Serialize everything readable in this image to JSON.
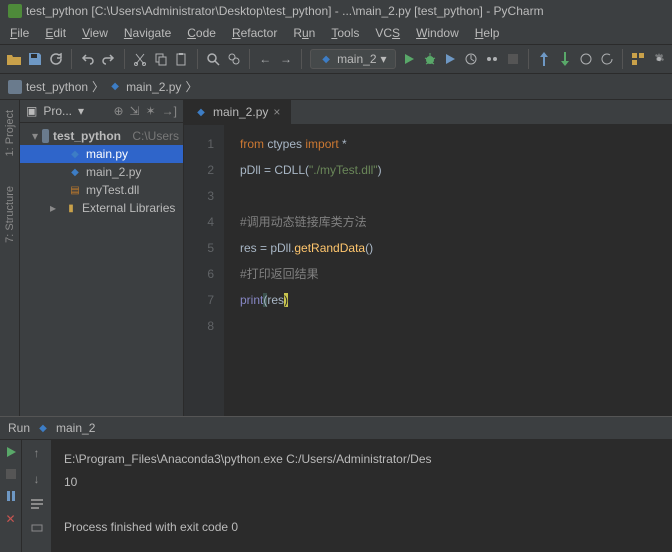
{
  "title": "test_python [C:\\Users\\Administrator\\Desktop\\test_python] - ...\\main_2.py [test_python] - PyCharm",
  "menu": [
    "File",
    "Edit",
    "View",
    "Navigate",
    "Code",
    "Refactor",
    "Run",
    "Tools",
    "VCS",
    "Window",
    "Help"
  ],
  "runConfig": "main_2",
  "breadcrumb": {
    "project": "test_python",
    "file": "main_2.py"
  },
  "sideTools": [
    "1: Project",
    "7: Structure"
  ],
  "projectHeader": "Pro...",
  "tree": {
    "root": {
      "name": "test_python",
      "path": "C:\\Users"
    },
    "files": [
      {
        "name": "main.py",
        "type": "py",
        "sel": true
      },
      {
        "name": "main_2.py",
        "type": "py"
      },
      {
        "name": "myTest.dll",
        "type": "dll"
      }
    ],
    "ext": "External Libraries"
  },
  "tab": "main_2.py",
  "code": {
    "l1": "from ctypes import *",
    "l2": "pDll = CDLL(\"./myTest.dll\")",
    "l3": "",
    "l4": "#调用动态链接库类方法",
    "l5": "res = pDll.getRandData()",
    "l6": "#打印返回结果",
    "l7": "print(res)"
  },
  "runLabel": "Run",
  "runTarget": "main_2",
  "output": {
    "cmd": "E:\\Program_Files\\Anaconda3\\python.exe C:/Users/Administrator/Des",
    "val": "10",
    "exit": "Process finished with exit code 0"
  }
}
